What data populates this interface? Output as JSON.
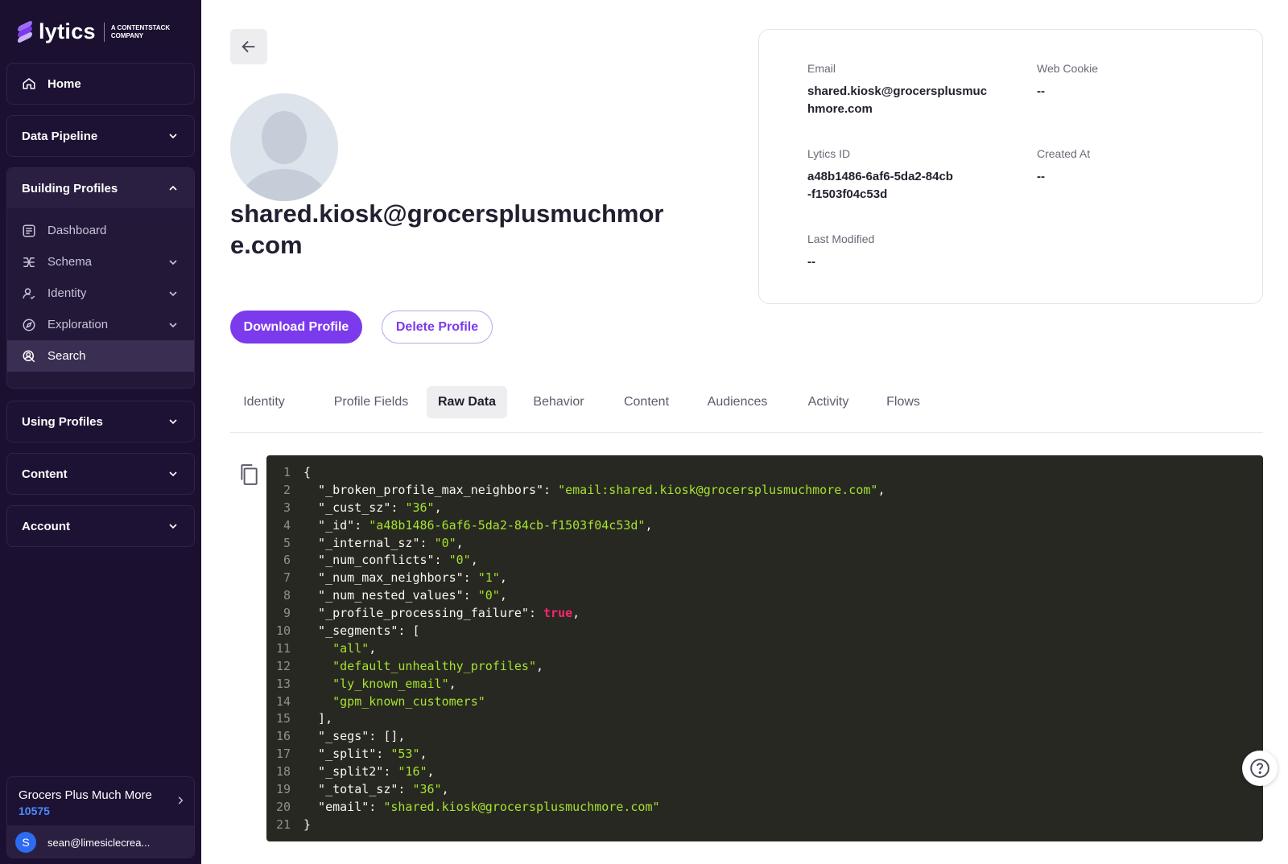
{
  "brand": {
    "name": "lytics",
    "tagline_line1": "A CONTENTSTACK",
    "tagline_line2": "COMPANY"
  },
  "sidebar": {
    "home": "Home",
    "data_pipeline": "Data Pipeline",
    "building_profiles": {
      "label": "Building Profiles",
      "items": [
        {
          "label": "Dashboard"
        },
        {
          "label": "Schema"
        },
        {
          "label": "Identity"
        },
        {
          "label": "Exploration"
        },
        {
          "label": "Search"
        }
      ]
    },
    "using_profiles": "Using Profiles",
    "content": "Content",
    "account": "Account",
    "org": {
      "name": "Grocers Plus Much More",
      "id": "10575"
    },
    "user": {
      "initial": "S",
      "email": "sean@limesiclecrea..."
    }
  },
  "profile": {
    "title": "shared.kiosk@grocersplusmuchmore.com",
    "download_label": "Download Profile",
    "delete_label": "Delete Profile"
  },
  "info": {
    "email_label": "Email",
    "email_value": "shared.kiosk@grocersplusmuchmore.com",
    "web_cookie_label": "Web Cookie",
    "web_cookie_value": "--",
    "lytics_id_label": "Lytics ID",
    "lytics_id_value": "a48b1486-6af6-5da2-84cb-f1503f04c53d",
    "created_at_label": "Created At",
    "created_at_value": "--",
    "last_modified_label": "Last Modified",
    "last_modified_value": "--"
  },
  "tabs": [
    "Identity",
    "Profile Fields",
    "Raw Data",
    "Behavior",
    "Content",
    "Audiences",
    "Activity",
    "Flows"
  ],
  "active_tab": "Raw Data",
  "code_lines": [
    [
      [
        "t",
        "{"
      ]
    ],
    [
      [
        "t",
        "  \"_broken_profile_max_neighbors\": "
      ],
      [
        "s",
        "\"email:shared.kiosk@grocersplusmuchmore.com\""
      ],
      [
        "t",
        ","
      ]
    ],
    [
      [
        "t",
        "  \"_cust_sz\": "
      ],
      [
        "s",
        "\"36\""
      ],
      [
        "t",
        ","
      ]
    ],
    [
      [
        "t",
        "  \"_id\": "
      ],
      [
        "s",
        "\"a48b1486-6af6-5da2-84cb-f1503f04c53d\""
      ],
      [
        "t",
        ","
      ]
    ],
    [
      [
        "t",
        "  \"_internal_sz\": "
      ],
      [
        "s",
        "\"0\""
      ],
      [
        "t",
        ","
      ]
    ],
    [
      [
        "t",
        "  \"_num_conflicts\": "
      ],
      [
        "s",
        "\"0\""
      ],
      [
        "t",
        ","
      ]
    ],
    [
      [
        "t",
        "  \"_num_max_neighbors\": "
      ],
      [
        "s",
        "\"1\""
      ],
      [
        "t",
        ","
      ]
    ],
    [
      [
        "t",
        "  \"_num_nested_values\": "
      ],
      [
        "s",
        "\"0\""
      ],
      [
        "t",
        ","
      ]
    ],
    [
      [
        "t",
        "  \"_profile_processing_failure\": "
      ],
      [
        "k",
        "true"
      ],
      [
        "t",
        ","
      ]
    ],
    [
      [
        "t",
        "  \"_segments\": ["
      ]
    ],
    [
      [
        "t",
        "    "
      ],
      [
        "s",
        "\"all\""
      ],
      [
        "t",
        ","
      ]
    ],
    [
      [
        "t",
        "    "
      ],
      [
        "s",
        "\"default_unhealthy_profiles\""
      ],
      [
        "t",
        ","
      ]
    ],
    [
      [
        "t",
        "    "
      ],
      [
        "s",
        "\"ly_known_email\""
      ],
      [
        "t",
        ","
      ]
    ],
    [
      [
        "t",
        "    "
      ],
      [
        "s",
        "\"gpm_known_customers\""
      ]
    ],
    [
      [
        "t",
        "  ],"
      ]
    ],
    [
      [
        "t",
        "  \"_segs\": [],"
      ]
    ],
    [
      [
        "t",
        "  \"_split\": "
      ],
      [
        "s",
        "\"53\""
      ],
      [
        "t",
        ","
      ]
    ],
    [
      [
        "t",
        "  \"_split2\": "
      ],
      [
        "s",
        "\"16\""
      ],
      [
        "t",
        ","
      ]
    ],
    [
      [
        "t",
        "  \"_total_sz\": "
      ],
      [
        "s",
        "\"36\""
      ],
      [
        "t",
        ","
      ]
    ],
    [
      [
        "t",
        "  \"email\": "
      ],
      [
        "s",
        "\"shared.kiosk@grocersplusmuchmore.com\""
      ]
    ],
    [
      [
        "t",
        "}"
      ]
    ]
  ],
  "colors": {
    "accent": "#7c3aed",
    "sidebar_bg": "#1b1030",
    "code_bg": "#272822",
    "string": "#a6e22e",
    "keyword": "#f92672"
  },
  "icons": [
    "home-icon",
    "chevron-down-icon",
    "chevron-up-icon",
    "dashboard-icon",
    "schema-icon",
    "identity-icon",
    "compass-icon",
    "search-user-icon",
    "chevron-right-icon",
    "arrow-left-icon",
    "copy-icon",
    "help-icon"
  ]
}
